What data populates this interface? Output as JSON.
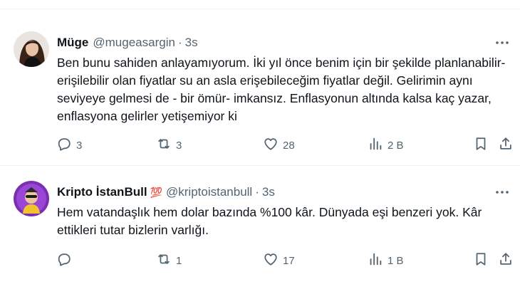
{
  "tweets": [
    {
      "name": "Müge",
      "badge": "",
      "handle": "@mugeasargin",
      "separator": "·",
      "time": "3s",
      "text": "Ben bunu sahiden anlayamıyorum. İki yıl önce benim için bir şekilde planlanabilir- erişilebilir olan fiyatlar su an asla erişebileceğim fiyatlar değil. Gelirimin aynı seviyeye gelmesi de - bir ömür- imkansız. Enflasyonun altında kalsa kaç yazar, enflasyona gelirler yetişemiyor ki",
      "replies": "3",
      "retweets": "3",
      "likes": "28",
      "views": "2 B",
      "icons": [
        "more-icon",
        "reply-icon",
        "retweet-icon",
        "like-icon",
        "views-icon",
        "bookmark-icon",
        "share-icon"
      ]
    },
    {
      "name": "Kripto İstanBull",
      "badge": "💯",
      "handle": "@kriptoistanbull",
      "separator": "·",
      "time": "3s",
      "text": "Hem vatandaşlık hem dolar bazında %100 kâr. Dünyada eşi benzeri yok. Kâr ettikleri tutar bizlerin varlığı.",
      "replies": "",
      "retweets": "1",
      "likes": "17",
      "views": "1 B",
      "icons": [
        "more-icon",
        "reply-icon",
        "retweet-icon",
        "like-icon",
        "views-icon",
        "bookmark-icon",
        "share-icon"
      ]
    }
  ],
  "colors": {
    "text": "#0f1419",
    "muted": "#536471",
    "divider": "#eff3f4",
    "badge": "#e0242e"
  }
}
